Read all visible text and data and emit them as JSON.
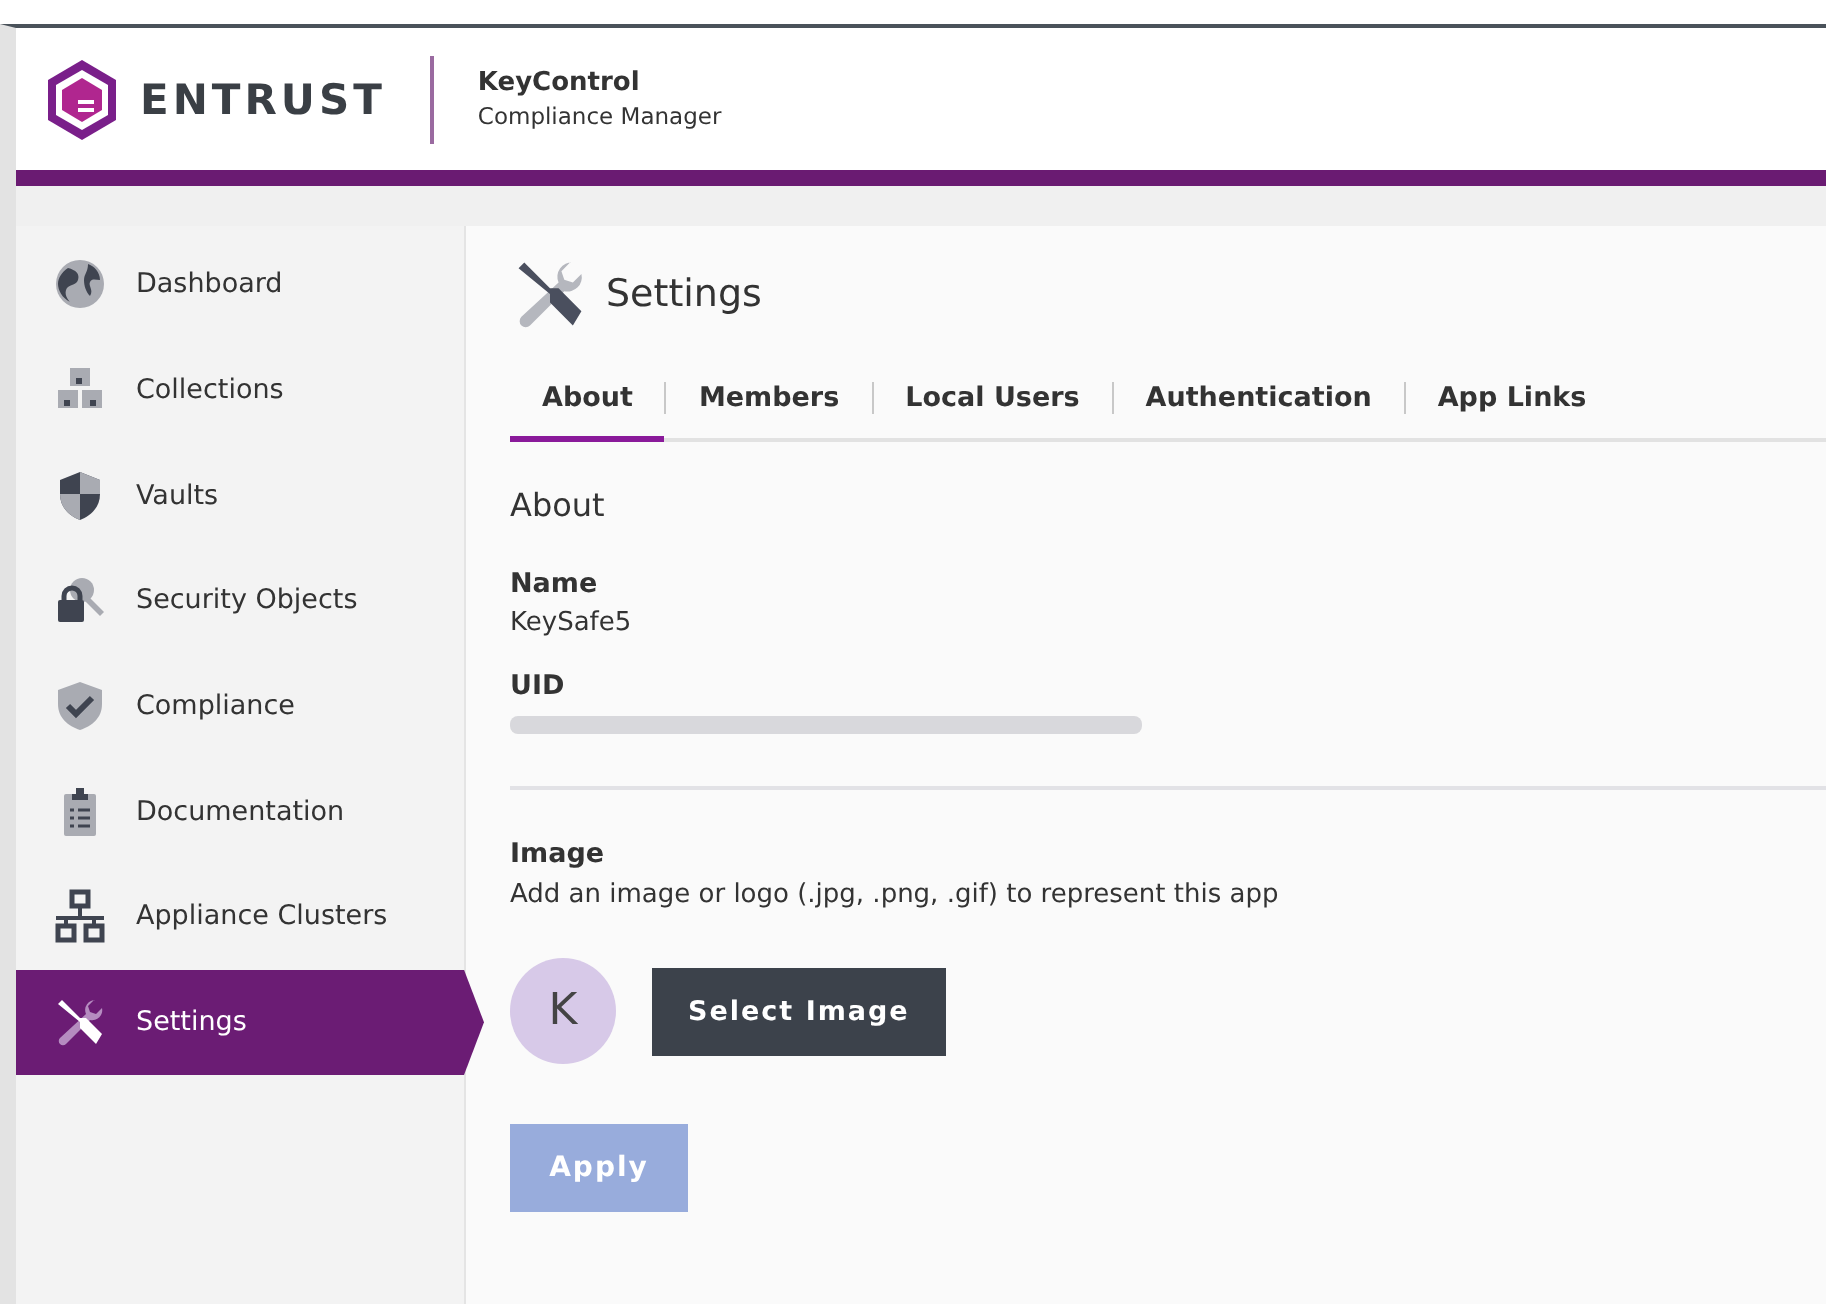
{
  "header": {
    "brand": "ENTRUST",
    "product": "KeyControl",
    "subtitle": "Compliance Manager"
  },
  "sidebar": {
    "items": [
      {
        "label": "Dashboard",
        "kind": "globe",
        "selected": false
      },
      {
        "label": "Collections",
        "kind": "boxes",
        "selected": false
      },
      {
        "label": "Vaults",
        "kind": "shield",
        "selected": false
      },
      {
        "label": "Security Objects",
        "kind": "lock",
        "selected": false
      },
      {
        "label": "Compliance",
        "kind": "check",
        "selected": false
      },
      {
        "label": "Documentation",
        "kind": "clipboard",
        "selected": false
      },
      {
        "label": "Appliance Clusters",
        "kind": "network",
        "selected": false
      },
      {
        "label": "Settings",
        "kind": "tools",
        "selected": true
      }
    ]
  },
  "page": {
    "title": "Settings",
    "tabs": [
      {
        "label": "About",
        "selected": true
      },
      {
        "label": "Members",
        "selected": false
      },
      {
        "label": "Local Users",
        "selected": false
      },
      {
        "label": "Authentication",
        "selected": false
      },
      {
        "label": "App Links",
        "selected": false
      }
    ],
    "section_title": "About",
    "fields": [
      {
        "label": "Name",
        "value": "KeySafe5",
        "redacted": false
      },
      {
        "label": "UID",
        "redacted": true
      }
    ],
    "image": {
      "label": "Image",
      "hint": "Add an image or logo (.jpg, .png, .gif) to represent this app",
      "avatar": "K",
      "button": "Select Image"
    },
    "apply": {
      "label": "Apply",
      "disabled": true
    }
  }
}
